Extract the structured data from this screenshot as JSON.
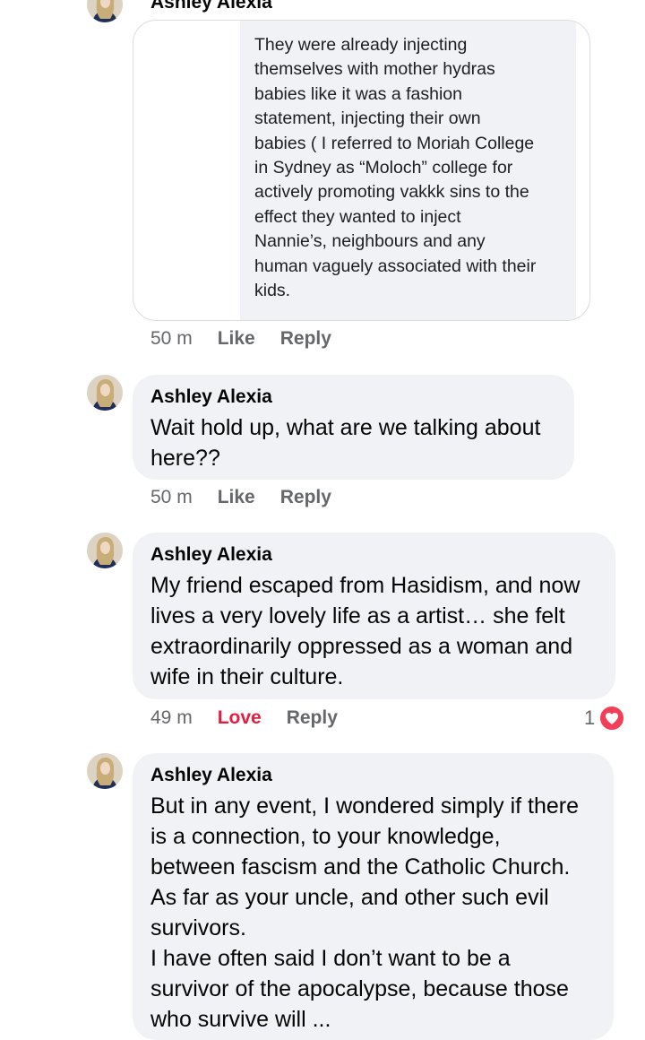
{
  "comments": [
    {
      "author": "Ashley Alexia",
      "quoted_text": "They were already injecting\nthemselves with mother hydras\nbabies like it was a fashion\nstatement, injecting their own\nbabies ( I referred to  Moriah College\nin Sydney as “Moloch” college for\nactively promoting vakkk sins to the\neffect they wanted to inject\nNannie’s, neighbours and any\nhuman vaguely associated with their\nkids.",
      "time": "50 m",
      "like_label": "Like",
      "reply_label": "Reply"
    },
    {
      "author": "Ashley Alexia",
      "text": "Wait hold up, what are we talking about\nhere??",
      "time": "50 m",
      "like_label": "Like",
      "reply_label": "Reply"
    },
    {
      "author": "Ashley Alexia",
      "text": "My friend escaped from Hasidism, and now\nlives a very lovely life as a artist… she felt\nextraordinarily oppressed as a woman and\nwife in their culture.",
      "time": "49 m",
      "like_label": "Love",
      "reply_label": "Reply",
      "reaction_count": "1",
      "reaction_icon": "heart-icon"
    },
    {
      "author": "Ashley Alexia",
      "text": "But in any event, I wondered simply if there\nis a connection, to your knowledge,\nbetween fascism and the Catholic Church.\nAs far as your uncle, and other such evil\nsurvivors.\nI have often said I don’t want to be a\nsurvivor of the apocalypse, because those\nwho survive will ..."
    }
  ],
  "colors": {
    "bubble": "#f0f2f5",
    "meta_text": "#65676b",
    "love": "#e41e3f",
    "heart_badge": "#f33e58"
  }
}
